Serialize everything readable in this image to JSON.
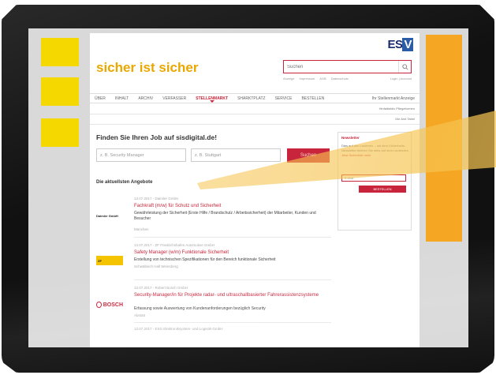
{
  "site": {
    "logo": {
      "prefix": "ES",
      "accent": "V"
    },
    "brand_name": "sicher ist sicher"
  },
  "search": {
    "placeholder": "Suchen",
    "meta": [
      "Anzeige",
      "Impressum",
      "AGB",
      "Datenschutz",
      "Login | Account"
    ]
  },
  "nav": {
    "items": [
      "ÜBER",
      "INHALT",
      "ARCHIV",
      "VERFASSER",
      "STELLENMARKT",
      "SHARKTPLATZ",
      "SERVICE",
      "BESTELLEN"
    ],
    "active_index": 4,
    "right_label": "Ihr Stellenmarkt Anzeige"
  },
  "sub_rows": [
    "Hinfaltiebliv Pflegeformen",
    "Die Arzt Tabel"
  ],
  "job_search": {
    "title": "Finden Sie Ihren Job auf sisdigital.de!",
    "what_placeholder": "z. B. Security Manager",
    "where_placeholder": "z. B. Stuttgart",
    "button_label": "Suchen"
  },
  "newsletter": {
    "title": "Newsletter",
    "text": "Dies auf den Laufenen – mit dem Sicherheits-Newsletter bleiben Sie stets auf dem Laufenden",
    "link": "Jetzt Sicherheit mehr",
    "email_placeholder": "E-Mail",
    "button_label": "BESTELLEN"
  },
  "offers": {
    "title": "Die aktuellsten Angebote",
    "jobs": [
      {
        "date": "13.07.2017 - Daimler GmbH",
        "title": "Fachkraft (m/w) für Schutz und Sicherheit",
        "desc": "Gewährleistung der Sicherheit (Erste Hilfe / Brandschutz / Arbeitssicherheit) der Mitarbeiter, Kunden und Besucher",
        "location": "München",
        "logo_text": "Daimler GmbH"
      },
      {
        "date": "13.07.2017 - ZF Friedrichshafen Automotive GmbH",
        "title": "Safety Manager (w/m) Funktionale Sicherheit",
        "desc": "Erstellung von technischen Spezifikationen für den Bereich funktionale Sicherheit",
        "location": "Schwäbisch Hall Weinsberg",
        "logo_text": "ZF"
      },
      {
        "date": "13.07.2017 - Robert Bosch GmbH",
        "title": "Security-Manager/in für Projekte radar- und ultraschallbasierter Fahrerassistenzsysteme",
        "desc": "Erfassung sowie Auswertung von Kundenanforderungen bezüglich Security",
        "location": "Abstatt",
        "logo_text": "BOSCH"
      },
      {
        "date": "13.07.2017 - ESG Elektroniksystem- und Logistik-GmbH",
        "title": "",
        "desc": "",
        "location": "",
        "logo_text": ""
      }
    ]
  },
  "colors": {
    "accent_red": "#c8243b",
    "brand_yellow": "#e8a800",
    "tab_yellow": "#f5d800",
    "side_orange": "#f5a623",
    "bezel": "#111111"
  }
}
